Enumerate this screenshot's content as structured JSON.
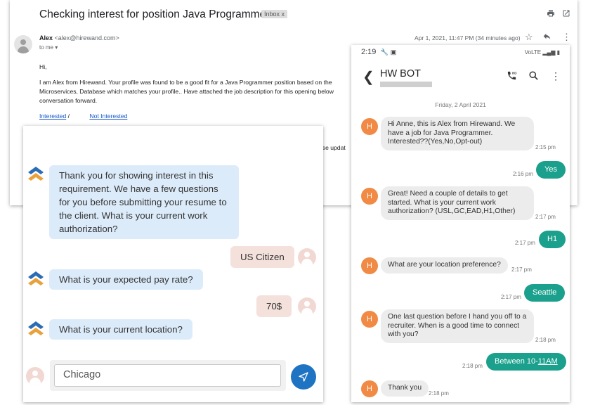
{
  "email": {
    "subject": "Checking interest for position Java Programmer",
    "badge": "Inbox x",
    "sender_name": "Alex",
    "sender_email": "<alex@hirewand.com>",
    "to": "to me",
    "date": "Apr 1, 2021, 11:47 PM (34 minutes ago)",
    "greeting": "Hi,",
    "body_line1": "I am Alex from Hirewand. Your profile was found to be a good fit for a Java Programmer position based on the",
    "body_line2": "Microservices, Database which matches your profile.. Have attached the job description for this opening below",
    "body_line3": "conversation forward.",
    "link_interested": "Interested",
    "separator": "/",
    "link_not_interested": "Not Interested",
    "update_fragment": "ase updat"
  },
  "webchat": {
    "messages": [
      {
        "from": "bot",
        "text": "Thank you for showing interest in this requirement. We have a few questions for you before submitting your resume to the client. What is your current work authorization?"
      },
      {
        "from": "user",
        "text": "US Citizen"
      },
      {
        "from": "bot",
        "text": "What is your expected pay rate?"
      },
      {
        "from": "user",
        "text": "70$"
      },
      {
        "from": "bot",
        "text": "What is your current location?"
      }
    ],
    "input_value": "Chicago"
  },
  "sms": {
    "status_time": "2:19",
    "status_icons": "VoLTE",
    "contact": "HW BOT",
    "avatar_letter": "H",
    "date_divider": "Friday, 2 April 2021",
    "messages": [
      {
        "from": "bot",
        "text": "Hi Anne, this is Alex from Hirewand. We have a job for Java Programmer. Interested??(Yes,No,Opt-out)",
        "time": "2:15 pm"
      },
      {
        "from": "me",
        "text": "Yes",
        "time": "2:16 pm"
      },
      {
        "from": "bot",
        "text": "Great! Need a couple of details to get started. What is your current work authorization? (USL,GC,EAD,H1,Other)",
        "time": "2:17 pm"
      },
      {
        "from": "me",
        "text": "H1",
        "time": "2:17 pm"
      },
      {
        "from": "bot",
        "text": "What are your location preference?",
        "time": "2:17 pm"
      },
      {
        "from": "me",
        "text": "Seattle",
        "time": "2:17 pm"
      },
      {
        "from": "bot",
        "text": "One last question before I hand you off to a recruiter. When is a good time to connect with you?",
        "time": "2:18 pm"
      },
      {
        "from": "me",
        "text_prefix": "Between 10-",
        "text_link": "11AM",
        "time": "2:18 pm"
      },
      {
        "from": "bot",
        "text": "Thank you",
        "time": "2:18 pm"
      }
    ]
  },
  "colors": {
    "bot_bubble": "#dcebfa",
    "user_bubble": "#f4e1dc",
    "send_button": "#1e73c3",
    "sms_out": "#1aa08c",
    "sms_avatar": "#f08a45",
    "link": "#1155cc"
  },
  "icons": [
    "print-icon",
    "open-new-window-icon",
    "star-icon",
    "reply-icon",
    "more-vert-icon",
    "back-arrow-icon",
    "hd-call-icon",
    "search-icon",
    "send-icon",
    "bot-logo-icon",
    "user-avatar-icon"
  ]
}
